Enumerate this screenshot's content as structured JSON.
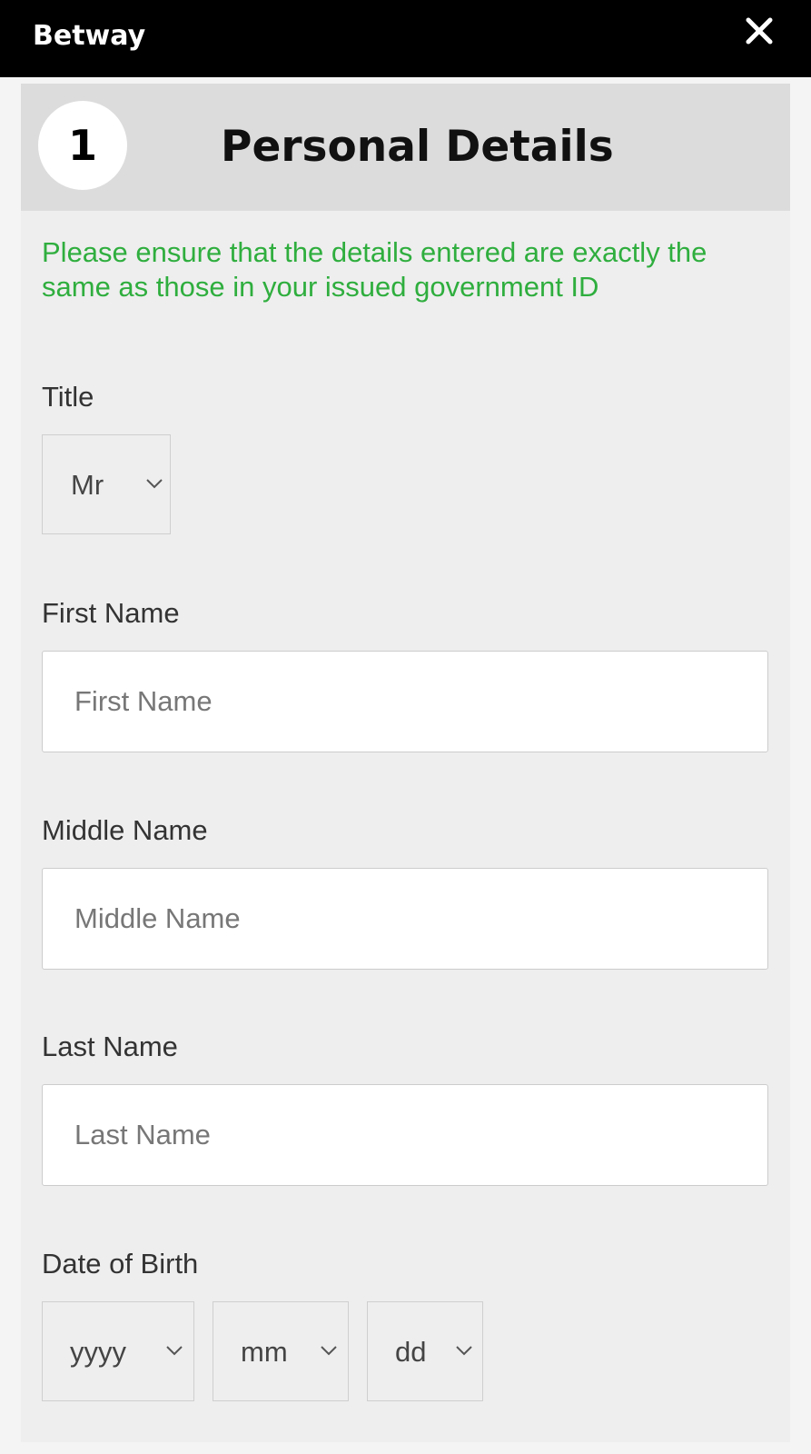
{
  "header": {
    "brand": "Betway",
    "close_icon": "close-icon"
  },
  "step": {
    "number": "1",
    "title": "Personal Details"
  },
  "notice": "Please ensure that the details entered are exactly the same as those in your issued government ID",
  "colors": {
    "topbar": "#000000",
    "notice_green": "#2fae3e",
    "panel": "#eeeeee",
    "step_header": "#dcdcdc"
  },
  "form": {
    "title": {
      "label": "Title",
      "selected": "Mr"
    },
    "first_name": {
      "label": "First Name",
      "placeholder": "First Name",
      "value": ""
    },
    "middle_name": {
      "label": "Middle Name",
      "placeholder": "Middle Name",
      "value": ""
    },
    "last_name": {
      "label": "Last Name",
      "placeholder": "Last Name",
      "value": ""
    },
    "dob": {
      "label": "Date of Birth",
      "year": "yyyy",
      "month": "mm",
      "day": "dd"
    }
  }
}
